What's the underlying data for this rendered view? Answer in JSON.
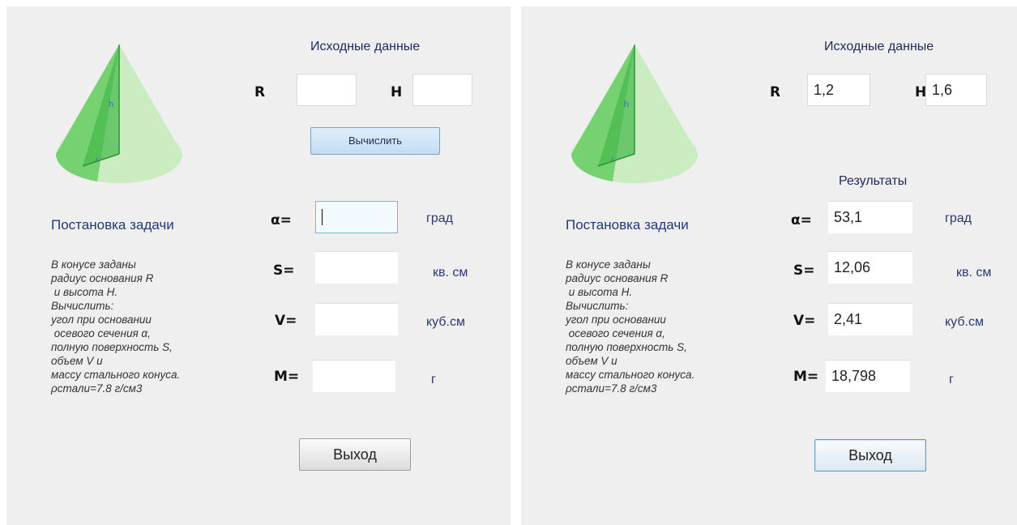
{
  "left": {
    "input_header": "Исходные данные",
    "r_label": "R",
    "h_label": "H",
    "r_value": "",
    "h_value": "",
    "calc_button": "Вычислить",
    "task_title": "Постановка задачи",
    "task_text": "В конусе заданы\nрадиус основания R\n и высота H.\nВычислить:\nугол при основании\n осевого сечения α,\nполную поверхность S,\nобъем V и\nмассу стального конуса.\nρстали=7.8 г/см3",
    "alpha_label": "α=",
    "s_label": "S=",
    "v_label": "V=",
    "m_label": "M=",
    "alpha_value": "",
    "s_value": "",
    "v_value": "",
    "m_value": "",
    "alpha_unit": "град",
    "s_unit": "кв. см",
    "v_unit": "куб.см",
    "m_unit": "г",
    "exit_button": "Выход"
  },
  "right": {
    "input_header": "Исходные данные",
    "r_label": "R",
    "h_label": "H",
    "r_value": "1,2",
    "h_value": "1,6",
    "results_header": "Результаты",
    "task_title": "Постановка задачи",
    "task_text": "В конусе заданы\nрадиус основания R\n и высота H.\nВычислить:\nугол при основании\n осевого сечения α,\nполную поверхность S,\nобъем V и\nмассу стального конуса.\nρстали=7.8 г/см3",
    "alpha_label": "α=",
    "s_label": "S=",
    "v_label": "V=",
    "m_label": "M=",
    "alpha_value": "53,1",
    "s_value": "12,06",
    "v_value": "2,41",
    "m_value": "18,798",
    "alpha_unit": "град",
    "s_unit": "кв. см",
    "v_unit": "куб.см",
    "m_unit": "г",
    "exit_button": "Выход"
  },
  "cone_labels": {
    "height": "h",
    "radius": "r"
  },
  "colors": {
    "form_bg": "#efefef",
    "cone_green": "#7ed27a",
    "calc_button_blue": "#c3dcf4",
    "label_blue": "#1f3a7a"
  }
}
